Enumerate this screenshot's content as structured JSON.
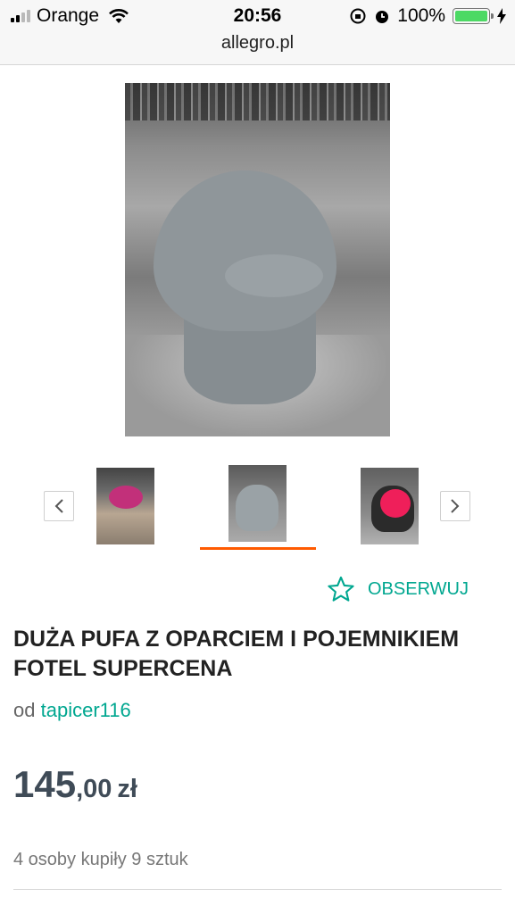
{
  "status_bar": {
    "carrier": "Orange",
    "time": "20:56",
    "battery_percent": "100%",
    "signal_bars": 4,
    "signal_bars_active": 2,
    "icons": [
      "signal-icon",
      "wifi-icon",
      "rotation-lock-icon",
      "alarm-icon",
      "battery-icon",
      "charging-icon"
    ]
  },
  "browser": {
    "url": "allegro.pl"
  },
  "gallery": {
    "prev_label": "‹",
    "next_label": "›",
    "thumbnails": [
      {
        "name": "thumbnail-1",
        "active": false
      },
      {
        "name": "thumbnail-2",
        "active": true
      },
      {
        "name": "thumbnail-3",
        "active": false
      }
    ],
    "active_color": "#ff5a00"
  },
  "observe": {
    "label": "OBSERWUJ",
    "icon": "star-outline-icon",
    "color": "#00a790"
  },
  "product": {
    "title": "DUŻA PUFA Z OPARCIEM I POJEMNIKIEM FOTEL SUPERCENA",
    "seller_prefix": "od",
    "seller_name": "tapicer116",
    "price_int": "145",
    "price_dec": ",00",
    "currency": "zł",
    "sold_info": "4 osoby kupiły 9 sztuk"
  }
}
